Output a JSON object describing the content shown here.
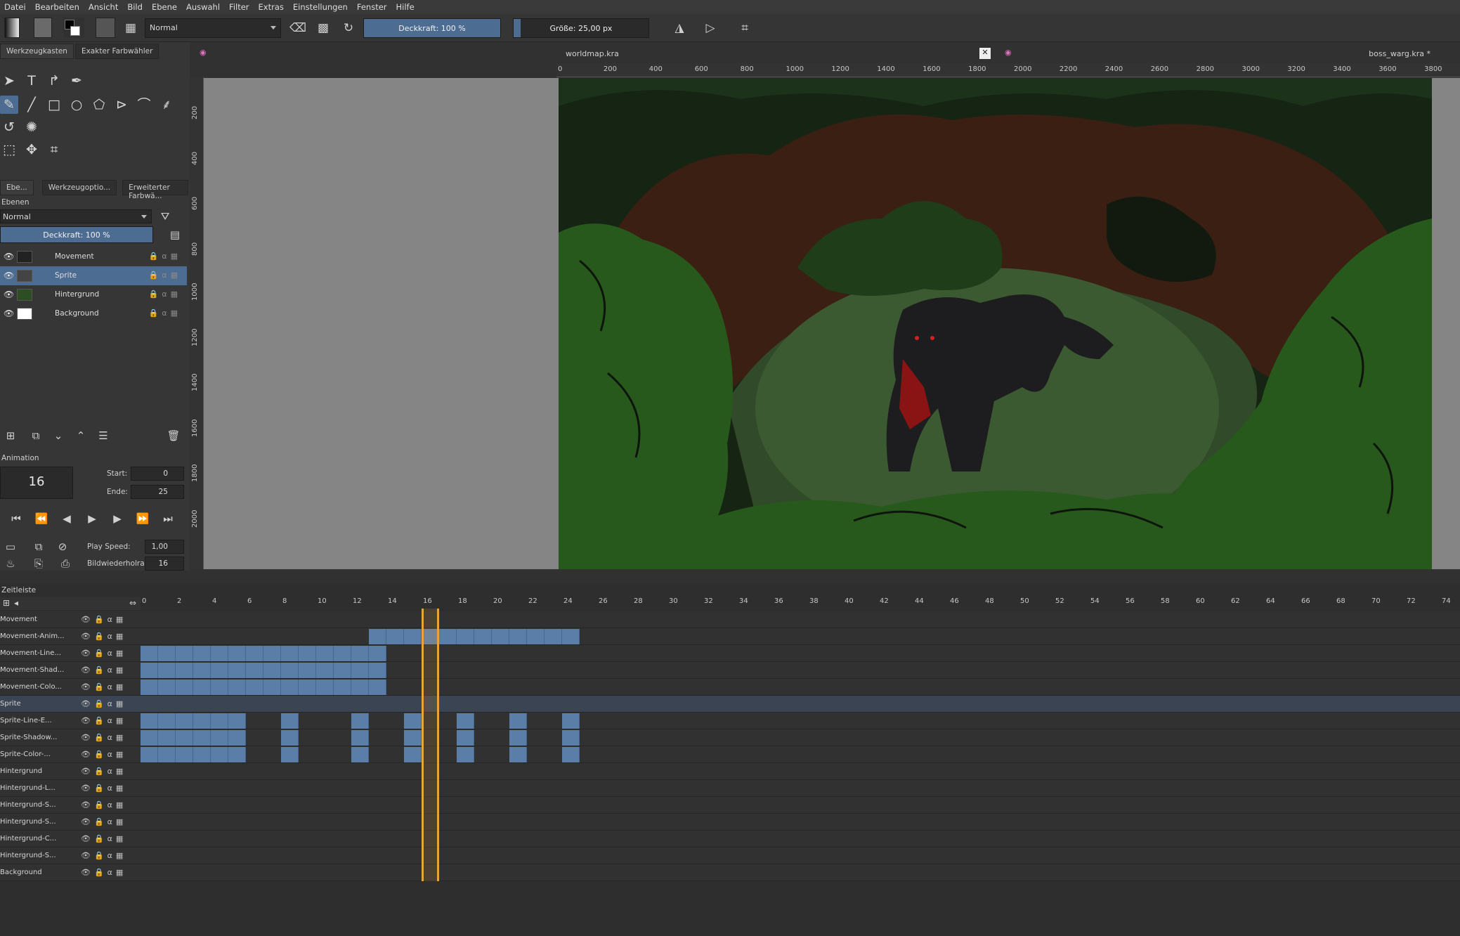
{
  "menu": [
    "Datei",
    "Bearbeiten",
    "Ansicht",
    "Bild",
    "Ebene",
    "Auswahl",
    "Filter",
    "Extras",
    "Einstellungen",
    "Fenster",
    "Hilfe"
  ],
  "toolbar": {
    "blend_mode": "Normal",
    "opacity_label": "Deckkraft: 100 %",
    "opacity_value": 1.0,
    "size_label": "Größe: 25,00 px",
    "size_value": 0.05
  },
  "left_tabs": [
    "Werkzeugkasten",
    "Exakter Farbwähler"
  ],
  "docker_tabs": [
    "Ebe...",
    "Werkzeugoptio...",
    "Erweiterter Farbwä..."
  ],
  "layers_panel": {
    "title": "Ebenen",
    "blend_mode": "Normal",
    "opacity_label": "Deckkraft:  100 %",
    "layers": [
      {
        "name": "Movement",
        "selected": false
      },
      {
        "name": "Sprite",
        "selected": true
      },
      {
        "name": "Hintergrund",
        "selected": false
      },
      {
        "name": "Background",
        "selected": false
      }
    ]
  },
  "animation_panel": {
    "title": "Animation",
    "current_frame": "16",
    "start_label": "Start:",
    "start_value": "0",
    "end_label": "Ende:",
    "end_value": "25",
    "play_speed_label": "Play Speed:",
    "play_speed_value": "1,00",
    "fps_label": "Bildwiederholrate:",
    "fps_value": "16"
  },
  "documents": {
    "tab1": "worldmap.kra",
    "tab2": "boss_warg.kra *"
  },
  "ruler_top": [
    "0",
    "200",
    "400",
    "600",
    "800",
    "1000",
    "1200",
    "1400",
    "1600",
    "1800",
    "2000",
    "2200",
    "2400",
    "2600",
    "2800",
    "3000",
    "3200",
    "3400",
    "3600",
    "3800"
  ],
  "ruler_left": [
    "200",
    "400",
    "600",
    "800",
    "1000",
    "1200",
    "1400",
    "1600",
    "1800",
    "2000"
  ],
  "timeline": {
    "title": "Zeitleiste",
    "frame_numbers": [
      "0",
      "2",
      "4",
      "6",
      "8",
      "10",
      "12",
      "14",
      "16",
      "18",
      "20",
      "22",
      "24",
      "26",
      "28",
      "30",
      "32",
      "34",
      "36",
      "38",
      "40",
      "42",
      "44",
      "46",
      "48",
      "50",
      "52",
      "54",
      "56",
      "58",
      "60",
      "62",
      "64",
      "66",
      "68",
      "70",
      "72",
      "74"
    ],
    "current_frame": 16,
    "rows": [
      {
        "name": "Movement",
        "group": true,
        "frames": []
      },
      {
        "name": "Movement-Anim...",
        "group": false,
        "frames": [
          13,
          14,
          15,
          16,
          17,
          18,
          19,
          20,
          21,
          22,
          23,
          24
        ]
      },
      {
        "name": "Movement-Line...",
        "group": false,
        "frames": [
          0,
          1,
          2,
          3,
          4,
          5,
          6,
          7,
          8,
          9,
          10,
          11,
          12,
          13
        ]
      },
      {
        "name": "Movement-Shad...",
        "group": false,
        "frames": [
          0,
          1,
          2,
          3,
          4,
          5,
          6,
          7,
          8,
          9,
          10,
          11,
          12,
          13
        ]
      },
      {
        "name": "Movement-Colo...",
        "group": false,
        "frames": [
          0,
          1,
          2,
          3,
          4,
          5,
          6,
          7,
          8,
          9,
          10,
          11,
          12,
          13
        ]
      },
      {
        "name": "Sprite",
        "group": true,
        "frames": []
      },
      {
        "name": "Sprite-Line-E...",
        "group": false,
        "frames": [
          0,
          1,
          2,
          3,
          4,
          5,
          8,
          12,
          15,
          18,
          21,
          24
        ]
      },
      {
        "name": "Sprite-Shadow...",
        "group": false,
        "frames": [
          0,
          1,
          2,
          3,
          4,
          5,
          8,
          12,
          15,
          18,
          21,
          24
        ]
      },
      {
        "name": "Sprite-Color-...",
        "group": false,
        "frames": [
          0,
          1,
          2,
          3,
          4,
          5,
          8,
          12,
          15,
          18,
          21,
          24
        ]
      },
      {
        "name": "Hintergrund",
        "group": true,
        "frames": []
      },
      {
        "name": "Hintergrund-L...",
        "group": false,
        "frames": []
      },
      {
        "name": "Hintergrund-S...",
        "group": false,
        "frames": []
      },
      {
        "name": "Hintergrund-S...",
        "group": false,
        "frames": []
      },
      {
        "name": "Hintergrund-C...",
        "group": false,
        "frames": []
      },
      {
        "name": "Hintergrund-S...",
        "group": false,
        "frames": []
      },
      {
        "name": "Background",
        "group": false,
        "frames": []
      }
    ]
  },
  "colors": {
    "accent": "#4d6c92",
    "frame": "#5b7ea8",
    "playhead": "#e8a33c"
  }
}
